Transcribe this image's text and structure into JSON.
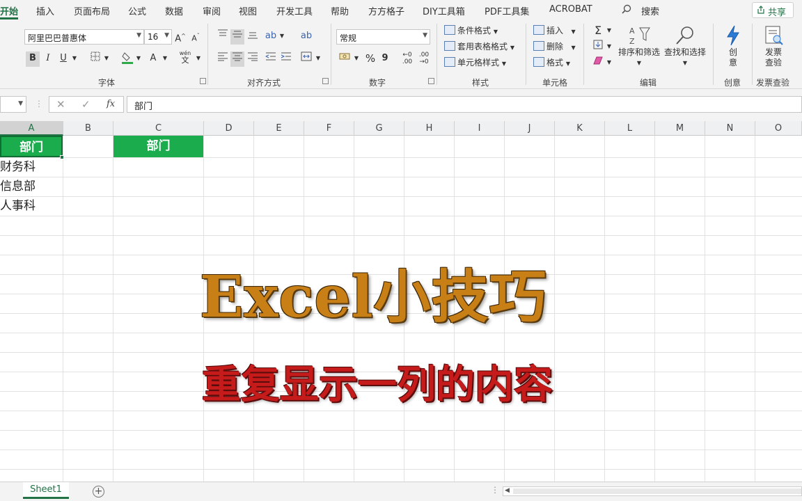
{
  "menu": {
    "tabs": [
      "开始",
      "插入",
      "页面布局",
      "公式",
      "数据",
      "审阅",
      "视图",
      "开发工具",
      "帮助",
      "方方格子",
      "DIY工具箱",
      "PDF工具集",
      "ACROBAT"
    ],
    "search_label": "搜索",
    "share_label": "共享"
  },
  "ribbon": {
    "font": {
      "font_name": "阿里巴巴普惠体",
      "font_size": "16",
      "bold": "B",
      "italic": "I",
      "underline": "U",
      "phonetic_top": "wén",
      "phonetic_bottom": "文",
      "group_label": "字体"
    },
    "alignment": {
      "group_label": "对齐方式"
    },
    "number": {
      "format": "常规",
      "percent": "%",
      "comma": "9",
      "group_label": "数字"
    },
    "styles": {
      "conditional": "条件格式",
      "table": "套用表格格式",
      "cell_styles": "单元格样式",
      "group_label": "样式"
    },
    "cells": {
      "insert": "插入",
      "delete": "删除",
      "format": "格式",
      "group_label": "单元格"
    },
    "editing": {
      "sort_filter": "排序和筛选",
      "find_select": "查找和选择",
      "group_label": "编辑"
    },
    "creative": {
      "label_1": "创",
      "label_2": "意",
      "group_label": "创意"
    },
    "invoice": {
      "label_1": "发票",
      "label_2": "查验",
      "group_label": "发票查验"
    }
  },
  "formula_bar": {
    "fx": "fx",
    "value": "部门"
  },
  "columns": [
    "A",
    "B",
    "C",
    "D",
    "E",
    "F",
    "G",
    "H",
    "I",
    "J",
    "K",
    "L",
    "M",
    "N",
    "O"
  ],
  "cells": {
    "A1": "部门",
    "A2": "财务科",
    "A3": "信息部",
    "A4": "人事科",
    "C1": "部门"
  },
  "overlay": {
    "title": "Excel小技巧",
    "subtitle": "重复显示一列的内容"
  },
  "sheets": [
    "Sheet1"
  ],
  "colors": {
    "excel_green": "#217346",
    "header_fill": "#1bac4e",
    "title": "#c87f16",
    "subtitle": "#c61b1b"
  }
}
